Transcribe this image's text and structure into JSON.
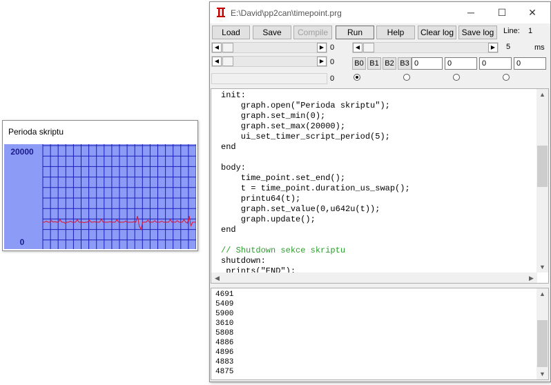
{
  "graph_window": {
    "title": "Perioda skriptu",
    "max_label": "20000",
    "min_label": "0",
    "colors": {
      "background": "#8c9cf6",
      "grid": "#1c1cb8",
      "trace": "#e0102a",
      "label": "#1a1a8c"
    },
    "chart_data": {
      "type": "line",
      "ylim": [
        0,
        20000
      ],
      "values": [
        5000,
        5000,
        5200,
        5000,
        5000,
        5300,
        5000,
        5100,
        5000,
        5000,
        5500,
        5000,
        5000,
        4800,
        5000,
        5000,
        5200,
        5000,
        5000,
        5000,
        5500,
        5000,
        5000,
        5000,
        4900,
        5000,
        5000,
        5400,
        5000,
        5000,
        5100,
        5000,
        5000,
        5000,
        5600,
        5000,
        5000,
        5000,
        5000,
        5100,
        5000,
        5000,
        5000,
        5500,
        5000,
        5000,
        5000,
        5000,
        5200,
        5000,
        5000,
        5000,
        5000,
        5100,
        5000,
        6200,
        4200,
        3600,
        5000,
        5000,
        5000,
        5400,
        5000,
        5000,
        5000,
        5300,
        5000,
        5000,
        5000,
        5200,
        5000,
        5000,
        5000,
        5000,
        5500,
        5000,
        5000,
        5000,
        5300,
        5000,
        5000,
        5000,
        5500,
        5000,
        4800,
        6200,
        4300,
        5000,
        5000,
        5000
      ]
    }
  },
  "main_window": {
    "title": "E:\\David\\pp2can\\timepoint.prg",
    "window_controls": {
      "minimize": "─",
      "maximize": "☐",
      "close": "✕"
    },
    "toolbar": {
      "load": "Load",
      "save": "Save",
      "compile": "Compile",
      "run": "Run",
      "help": "Help",
      "clear_log": "Clear log",
      "save_log": "Save log"
    },
    "line_label": "Line:",
    "line_value": "1",
    "sliders": [
      {
        "value": "0"
      },
      {
        "value": "0"
      },
      {
        "value": "0"
      }
    ],
    "timer": {
      "value": "5",
      "unit": "ms"
    },
    "b_buttons": [
      "B0",
      "B1",
      "B2",
      "B3"
    ],
    "fields": [
      "0",
      "0",
      "0",
      "0"
    ],
    "radio_selected": 0,
    "editor_lines": [
      {
        "text": "init:",
        "comment": false
      },
      {
        "text": "    graph.open(\"Perioda skriptu\");",
        "comment": false
      },
      {
        "text": "    graph.set_min(0);",
        "comment": false
      },
      {
        "text": "    graph.set_max(20000);",
        "comment": false
      },
      {
        "text": "    ui_set_timer_script_period(5);",
        "comment": false
      },
      {
        "text": "end",
        "comment": false
      },
      {
        "text": "",
        "comment": false
      },
      {
        "text": "body:",
        "comment": false
      },
      {
        "text": "    time_point.set_end();",
        "comment": false
      },
      {
        "text": "    t = time_point.duration_us_swap();",
        "comment": false
      },
      {
        "text": "    printu64(t);",
        "comment": false
      },
      {
        "text": "    graph.set_value(0,u642u(t));",
        "comment": false
      },
      {
        "text": "    graph.update();",
        "comment": false
      },
      {
        "text": "end",
        "comment": false
      },
      {
        "text": "",
        "comment": false
      },
      {
        "text": "// Shutdown sekce skriptu",
        "comment": true
      },
      {
        "text": "shutdown:",
        "comment": false
      },
      {
        "text": " prints(\"END\");",
        "comment": false
      }
    ],
    "log_lines": [
      "4691",
      "5409",
      "5900",
      "3610",
      "5808",
      "4886",
      "4896",
      "4883",
      "4875"
    ]
  }
}
